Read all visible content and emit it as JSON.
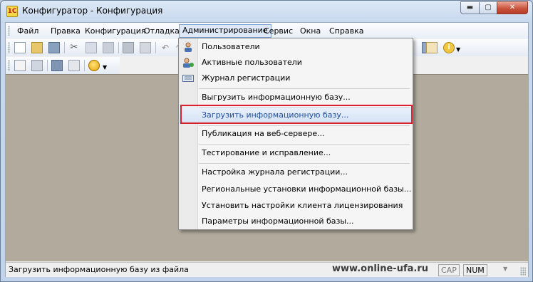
{
  "window": {
    "title": "Конфигуратор - Конфигурация",
    "app_icon_glyph": "1С",
    "minimize_glyph": "▬",
    "maximize_glyph": "▢",
    "close_glyph": "✕"
  },
  "menubar": {
    "items": [
      {
        "label": "Файл"
      },
      {
        "label": "Правка"
      },
      {
        "label": "Конфигурация"
      },
      {
        "label": "Отладка"
      },
      {
        "label": "Администрирование",
        "active": true
      },
      {
        "label": "Сервис"
      },
      {
        "label": "Окна"
      },
      {
        "label": "Справка"
      }
    ]
  },
  "admin_menu": {
    "items": [
      {
        "label": "Пользователи",
        "icon": "user-icon"
      },
      {
        "label": "Активные пользователи",
        "icon": "active-users-icon"
      },
      {
        "label": "Журнал регистрации",
        "icon": "log-icon"
      },
      {
        "label": "Выгрузить информационную базу..."
      },
      {
        "label": "Загрузить информационную базу...",
        "highlighted": true
      },
      {
        "label": "Публикация на веб-сервере..."
      },
      {
        "label": "Тестирование и исправление..."
      },
      {
        "label": "Настройка журнала регистрации..."
      },
      {
        "label": "Региональные установки информационной базы..."
      },
      {
        "label": "Установить настройки клиента лицензирования"
      },
      {
        "label": "Параметры информационной базы..."
      }
    ]
  },
  "statusbar": {
    "text": "Загрузить информационную базу из файла",
    "watermark": "www.online-ufa.ru",
    "cap": "CAP",
    "num": "NUM"
  },
  "colors": {
    "highlight_border": "#d8202e",
    "workspace": "#b2ab9d",
    "highlight_text": "#1f4d9c"
  }
}
